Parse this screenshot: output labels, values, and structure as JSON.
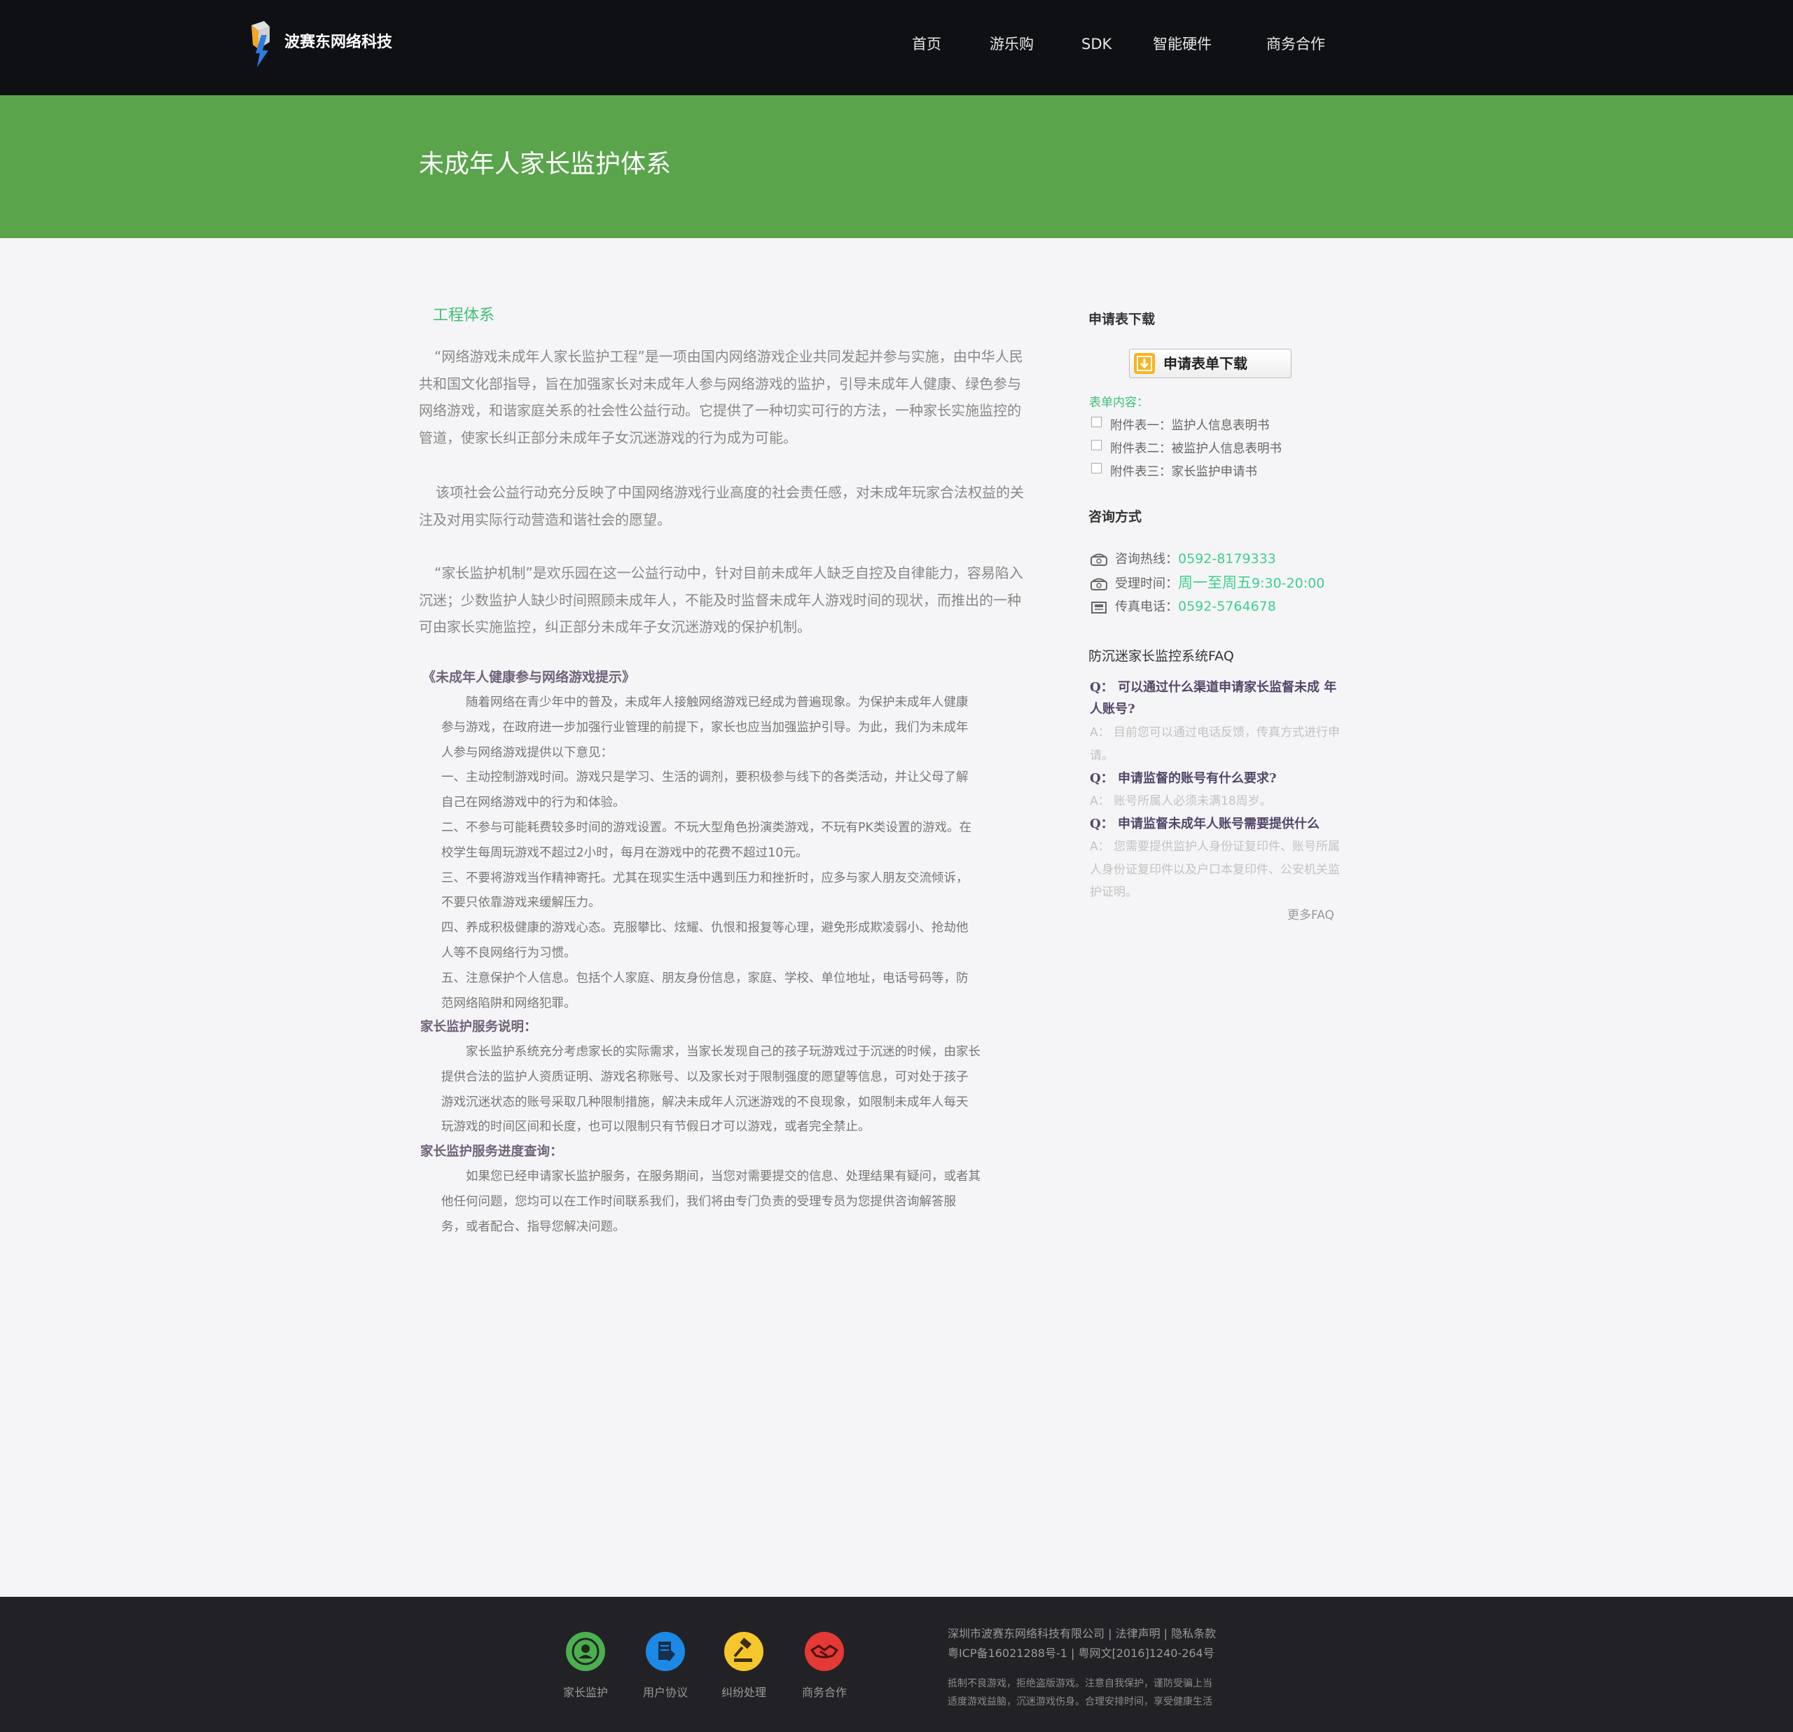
{
  "header": {
    "brand": "波赛东网络科技",
    "nav": [
      "首页",
      "游乐购",
      "SDK",
      "智能硬件",
      "商务合作"
    ]
  },
  "banner": {
    "title": "未成年人家长监护体系"
  },
  "main": {
    "section_title": "工程体系",
    "paragraphs": [
      {
        "lines": [
          "“网络游戏未成年人家长监护工程”是一项由国内网络游戏企业共同发起并参与实施，由中华人民",
          "共和国文化部指导，旨在加强家长对未成年人参与网络游戏的监护，引导未成年人健康、绿色参与",
          "网络游戏，和谐家庭关系的社会性公益行动。它提供了一种切实可行的方法，一种家长实施监控的",
          "管道，使家长纠正部分未成年子女沉迷游戏的行为成为可能。"
        ]
      },
      {
        "lines": [
          "该项社会公益行动充分反映了中国网络游戏行业高度的社会责任感，对未成年玩家合法权益的关",
          "注及对用实际行动营造和谐社会的愿望。"
        ]
      },
      {
        "lines": [
          "“家长监护机制”是欢乐园在这一公益行动中，针对目前未成年人缺乏自控及自律能力，容易陷入",
          "沉迷；少数监护人缺少时间照顾未成年人，不能及时监督未成年人游戏时间的现状，而推出的一种",
          "可由家长实施监控，纠正部分未成年子女沉迷游戏的保护机制。"
        ]
      }
    ],
    "tips_title": "《未成年人健康参与网络游戏提示》",
    "tips_lines": [
      "　　随着网络在青少年中的普及，未成年人接触网络游戏已经成为普遍现象。为保护未成年人健康",
      "参与游戏，在政府进一步加强行业管理的前提下，家长也应当加强监护引导。为此，我们为未成年",
      "人参与网络游戏提供以下意见：",
      "一、主动控制游戏时间。游戏只是学习、生活的调剂，要积极参与线下的各类活动，并让父母了解",
      "自己在网络游戏中的行为和体验。",
      "二、不参与可能耗费较多时间的游戏设置。不玩大型角色扮演类游戏，不玩有PK类设置的游戏。在",
      "校学生每周玩游戏不超过2小时，每月在游戏中的花费不超过10元。",
      "三、不要将游戏当作精神寄托。尤其在现实生活中遇到压力和挫折时，应多与家人朋友交流倾诉，",
      "不要只依靠游戏来缓解压力。",
      "四、养成积极健康的游戏心态。克服攀比、炫耀、仇恨和报复等心理，避免形成欺凌弱小、抢劫他",
      "人等不良网络行为习惯。",
      "五、注意保护个人信息。包括个人家庭、朋友身份信息，家庭、学校、单位地址，电话号码等，防",
      "范网络陷阱和网络犯罪。"
    ],
    "service_title": "家长监护服务说明：",
    "service_lines": [
      "　　家长监护系统充分考虑家长的实际需求，当家长发现自己的孩子玩游戏过于沉迷的时候，由家长",
      "提供合法的监护人资质证明、游戏名称账号、以及家长对于限制强度的愿望等信息，可对处于孩子",
      "游戏沉迷状态的账号采取几种限制措施，解决未成年人沉迷游戏的不良现象，如限制未成年人每天",
      "玩游戏的时间区间和长度，也可以限制只有节假日才可以游戏，或者完全禁止。"
    ],
    "progress_title": "家长监护服务进度查询：",
    "progress_lines": [
      "　　如果您已经申请家长监护服务，在服务期间，当您对需要提交的信息、处理结果有疑问，或者其",
      "他任何问题，您均可以在工作时间联系我们，我们将由专门负责的受理专员为您提供咨询解答服",
      "务，或者配合、指导您解决问题。"
    ]
  },
  "sidebar": {
    "download_title": "申请表下载",
    "download_button": "申请表单下载",
    "form_label": "表单内容：",
    "attachments": [
      "附件表一：监护人信息表明书",
      "附件表二：被监护人信息表明书",
      "附件表三：家长监护申请书"
    ],
    "contact_title": "咨询方式",
    "contact": {
      "hotline_label": "咨询热线：",
      "hotline": "0592-8179333",
      "hours_label": "受理时间：",
      "hours_days": "周一至周五",
      "hours_time": "9:30-20:00",
      "fax_label": "传真电话：",
      "fax": "0592-5764678"
    },
    "faq_title": "防沉迷家长监控系统FAQ",
    "faq": [
      {
        "q": "Q：  可以通过什么渠道申请家长监督未成 年人账号?",
        "a": "A：  目前您可以通过电话反馈，传真方式进行申请。"
      },
      {
        "q": "Q：  申请监督的账号有什么要求?",
        "a": "A：  账号所属人必须未满18周岁。"
      },
      {
        "q": "Q：  申请监督未成年人账号需要提供什么",
        "a": "A：  您需要提供监护人身份证复印件、账号所属人身份证复印件以及户口本复印件、公安机关监护证明。"
      }
    ],
    "faq_more": "更多FAQ"
  },
  "footer": {
    "links": [
      {
        "label": "家长监护",
        "icon": "guardian-icon",
        "color": "#4caf50"
      },
      {
        "label": "用户协议",
        "icon": "agreement-icon",
        "color": "#1e88e5"
      },
      {
        "label": "纠纷处理",
        "icon": "gavel-icon",
        "color": "#f6c72c"
      },
      {
        "label": "商务合作",
        "icon": "handshake-icon",
        "color": "#e53935"
      }
    ],
    "company_line": "深圳市波赛东网络科技有限公司 | 法律声明 | 隐私条款",
    "icp_line": "粤ICP备16021288号-1 | 粤网文[2016]1240-264号",
    "notice_line1": "抵制不良游戏，拒绝盗版游戏。注意自我保护，谨防受骗上当",
    "notice_line2": "适度游戏益脑，沉迷游戏伤身。合理安排时间，享受健康生活"
  }
}
